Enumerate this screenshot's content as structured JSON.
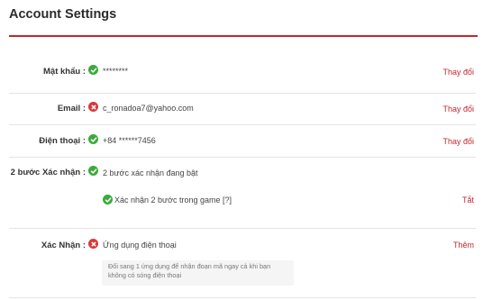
{
  "page": {
    "title": "Account Settings"
  },
  "rows": {
    "password": {
      "label": "Mật khẩu :",
      "status": "ok",
      "value": "********",
      "action": "Thay đổi"
    },
    "email": {
      "label": "Email :",
      "status": "error",
      "value": "c_ronadoa7@yahoo.com",
      "action": "Thay đổi"
    },
    "phone": {
      "label": "Điện thoại :",
      "status": "ok",
      "value": "+84 ******7456",
      "action": "Thay đổi"
    },
    "two_step": {
      "label": "2 bước Xác nhận :",
      "status": "ok",
      "value": "2 bước xác nhận đang bật",
      "sub_status": "ok",
      "sub_value": "Xác nhận 2 bước trong game [?]",
      "sub_action": "Tắt"
    },
    "verify": {
      "label": "Xác Nhận :",
      "status": "error",
      "value": "Ứng dụng điện thoại",
      "action": "Thêm",
      "hint_line1": "Đổi sang 1 ứng dụng để nhận đoạn mã ngay cả khi bạn",
      "hint_line2": "không có sóng điện thoại"
    }
  },
  "icons": {
    "ok": "check-circle-icon",
    "error": "x-circle-icon"
  },
  "colors": {
    "accent": "#c0272d",
    "ok": "#3caa3c",
    "error": "#d9383a"
  }
}
